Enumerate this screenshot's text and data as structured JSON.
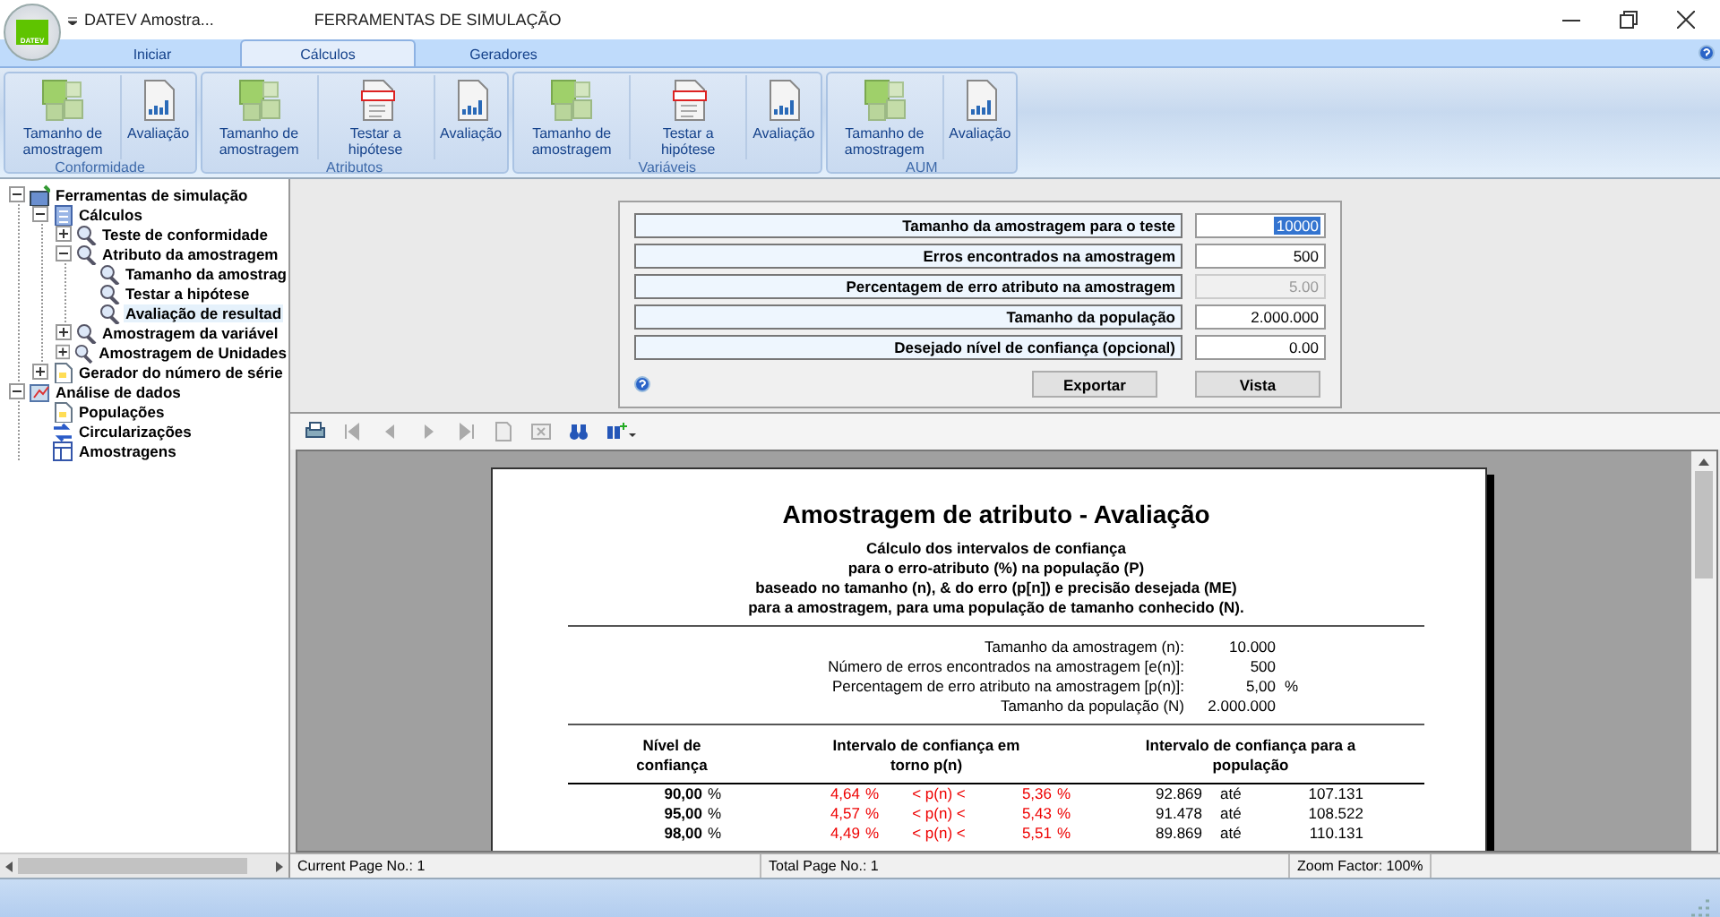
{
  "window": {
    "app_name": "DATEV Amostra...",
    "logo_text": "DATEV",
    "title": "FERRAMENTAS DE SIMULAÇÃO"
  },
  "tabs": [
    {
      "label": "Iniciar",
      "selected": false
    },
    {
      "label": "Cálculos",
      "selected": true
    },
    {
      "label": "Geradores",
      "selected": false
    }
  ],
  "ribbon_groups": [
    {
      "label": "Conformidade",
      "buttons": [
        {
          "kind": "size",
          "label": "Tamanho de amostragem"
        },
        {
          "kind": "eval",
          "label": "Avaliação"
        }
      ]
    },
    {
      "label": "Atributos",
      "buttons": [
        {
          "kind": "size",
          "label": "Tamanho de amostragem"
        },
        {
          "kind": "test",
          "label": "Testar a hipótese"
        },
        {
          "kind": "eval",
          "label": "Avaliação"
        }
      ]
    },
    {
      "label": "Variáveis",
      "buttons": [
        {
          "kind": "size",
          "label": "Tamanho de amostragem"
        },
        {
          "kind": "test",
          "label": "Testar a hipótese"
        },
        {
          "kind": "eval",
          "label": "Avaliação"
        }
      ]
    },
    {
      "label": "AUM",
      "buttons": [
        {
          "kind": "size",
          "label": "Tamanho de amostragem"
        },
        {
          "kind": "eval",
          "label": "Avaliação"
        }
      ]
    }
  ],
  "tree": [
    {
      "label": "Ferramentas de simulação",
      "kind": "tools",
      "expanded": true,
      "selected": false,
      "children": [
        {
          "label": "Cálculos",
          "kind": "calc",
          "expanded": true,
          "selected": false,
          "children": [
            {
              "label": "Teste de conformidade",
              "kind": "search",
              "expanded": false,
              "selected": false
            },
            {
              "label": "Atributo da amostragem",
              "kind": "search",
              "expanded": true,
              "selected": false,
              "children": [
                {
                  "label": "Tamanho da amostrag",
                  "kind": "search",
                  "selected": false
                },
                {
                  "label": "Testar a hipótese",
                  "kind": "search",
                  "selected": false
                },
                {
                  "label": "Avaliação de resultad",
                  "kind": "search",
                  "selected": true
                }
              ]
            },
            {
              "label": "Amostragem da variável",
              "kind": "search",
              "expanded": false,
              "selected": false
            },
            {
              "label": "Amostragem de Unidades",
              "kind": "search",
              "expanded": false,
              "selected": false
            }
          ]
        },
        {
          "label": "Gerador do número de série",
          "kind": "doc",
          "expanded": false,
          "selected": false
        }
      ]
    },
    {
      "label": "Análise de dados",
      "kind": "data",
      "expanded": true,
      "selected": false,
      "children": [
        {
          "label": "Populações",
          "kind": "doc",
          "selected": false
        },
        {
          "label": "Circularizações",
          "kind": "arrows",
          "selected": false
        },
        {
          "label": "Amostragens",
          "kind": "table",
          "selected": false
        }
      ]
    }
  ],
  "form": {
    "fields": [
      {
        "label": "Tamanho da amostragem para o teste",
        "value": "10000",
        "disabled": false,
        "focused": true
      },
      {
        "label": "Erros encontrados na amostragem",
        "value": "500",
        "disabled": false,
        "focused": false
      },
      {
        "label": "Percentagem de erro atributo na amostragem",
        "value": "5.00",
        "disabled": true,
        "focused": false
      },
      {
        "label": "Tamanho da população",
        "value": "2.000.000",
        "disabled": false,
        "focused": false
      },
      {
        "label": "Desejado nível de confiança (opcional)",
        "value": "0.00",
        "disabled": false,
        "focused": false
      }
    ],
    "buttons": [
      "Exportar",
      "Vista"
    ]
  },
  "report": {
    "title": "Amostragem de atributo - Avaliação",
    "subtitle_lines": [
      "Cálculo dos intervalos de confiança",
      "para o erro-atributo (%) na população (P)",
      "baseado no tamanho (n), & do erro (p[n]) e precisão desejada (ME)",
      "para a amostragem, para uma população de tamanho conhecido (N)."
    ],
    "summary": [
      {
        "label": "Tamanho da amostragem (n):",
        "value": "10.000"
      },
      {
        "label": "Número de erros encontrados na amostragem [e(n)]:",
        "value": "500"
      },
      {
        "label": "Percentagem de erro atributo na amostragem [p(n)]:",
        "value": "5,00",
        "unit": "%"
      },
      {
        "label": "Tamanho da população (N)",
        "value": "2.000.000"
      }
    ],
    "columns": [
      "Nível de confiança",
      "Intervalo de confiança em torno p(n)",
      "Intervalo de confiança para a população"
    ],
    "rows": [
      {
        "level": "90,00",
        "level_unit": "%",
        "low": "4,64",
        "low_unit": "%",
        "between": "< p(n) <",
        "high": "5,36",
        "high_unit": "%",
        "pop_low": "92.869",
        "until": "até",
        "pop_high": "107.131"
      },
      {
        "level": "95,00",
        "level_unit": "%",
        "low": "4,57",
        "low_unit": "%",
        "between": "< p(n) <",
        "high": "5,43",
        "high_unit": "%",
        "pop_low": "91.478",
        "until": "até",
        "pop_high": "108.522"
      },
      {
        "level": "98,00",
        "level_unit": "%",
        "low": "4,49",
        "low_unit": "%",
        "between": "< p(n) <",
        "high": "5,51",
        "high_unit": "%",
        "pop_low": "89.869",
        "until": "até",
        "pop_high": "110.131"
      }
    ]
  },
  "status_bar": [
    "Current Page No.: 1",
    "Total Page No.: 1",
    "Zoom Factor: 100%"
  ]
}
